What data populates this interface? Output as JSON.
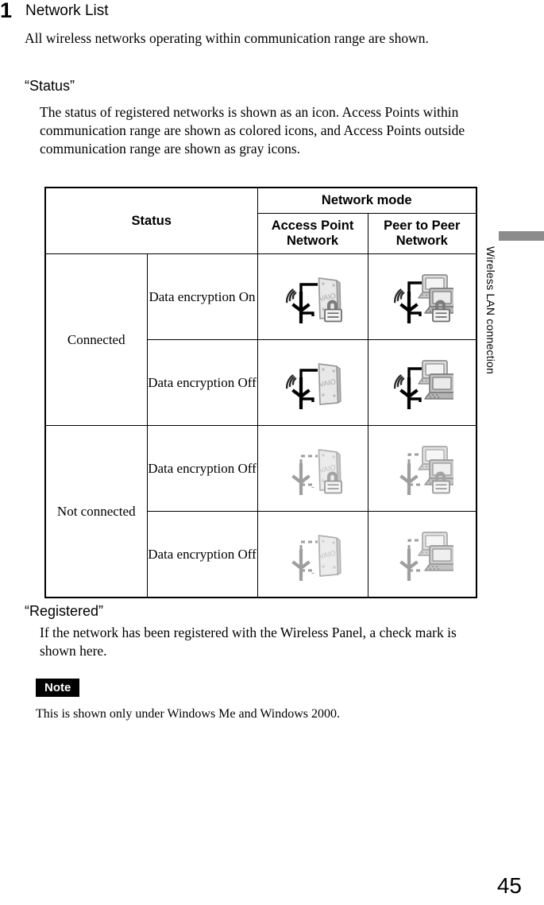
{
  "step": {
    "number": "1",
    "title": "Network List"
  },
  "intro": {
    "paragraph": "All wireless networks operating within communication range are shown."
  },
  "sections": {
    "status": {
      "heading": "“Status”",
      "description": "The status of registered networks is shown as an icon. Access Points within communication range are shown as colored icons, and Access Points outside communication range are shown as gray icons."
    },
    "registered": {
      "heading": "“Registered”",
      "description": "If the network has been registered with the Wireless Panel, a check mark is shown here."
    }
  },
  "note": {
    "badge_label": "Note",
    "text": "This is shown only under Windows Me and Windows 2000."
  },
  "table": {
    "header": {
      "status_label": "Status",
      "network_mode_label": "Network mode",
      "access_point_label": "Access Point Network",
      "peer_to_peer_label": "Peer to Peer Network"
    },
    "groups": [
      {
        "status_label": "Connected",
        "rows": [
          {
            "encryption_label": "Data encryption On",
            "access_point_icon": "antenna-accesspoint-locked-color-icon",
            "peer_to_peer_icon": "antenna-peers-locked-color-icon"
          },
          {
            "encryption_label": "Data encryption Off",
            "access_point_icon": "antenna-accesspoint-unlocked-color-icon",
            "peer_to_peer_icon": "antenna-peers-unlocked-color-icon"
          }
        ]
      },
      {
        "status_label": "Not connected",
        "rows": [
          {
            "encryption_label": "Data encryption Off",
            "access_point_icon": "antenna-accesspoint-locked-gray-icon",
            "peer_to_peer_icon": "antenna-peers-locked-gray-icon"
          },
          {
            "encryption_label": "Data encryption Off",
            "access_point_icon": "antenna-accesspoint-unlocked-gray-icon",
            "peer_to_peer_icon": "antenna-peers-unlocked-gray-icon"
          }
        ]
      }
    ]
  },
  "side_tab": {
    "label": "Wireless LAN connection",
    "bar_color": "#8c8c8c"
  },
  "page_number": "45"
}
